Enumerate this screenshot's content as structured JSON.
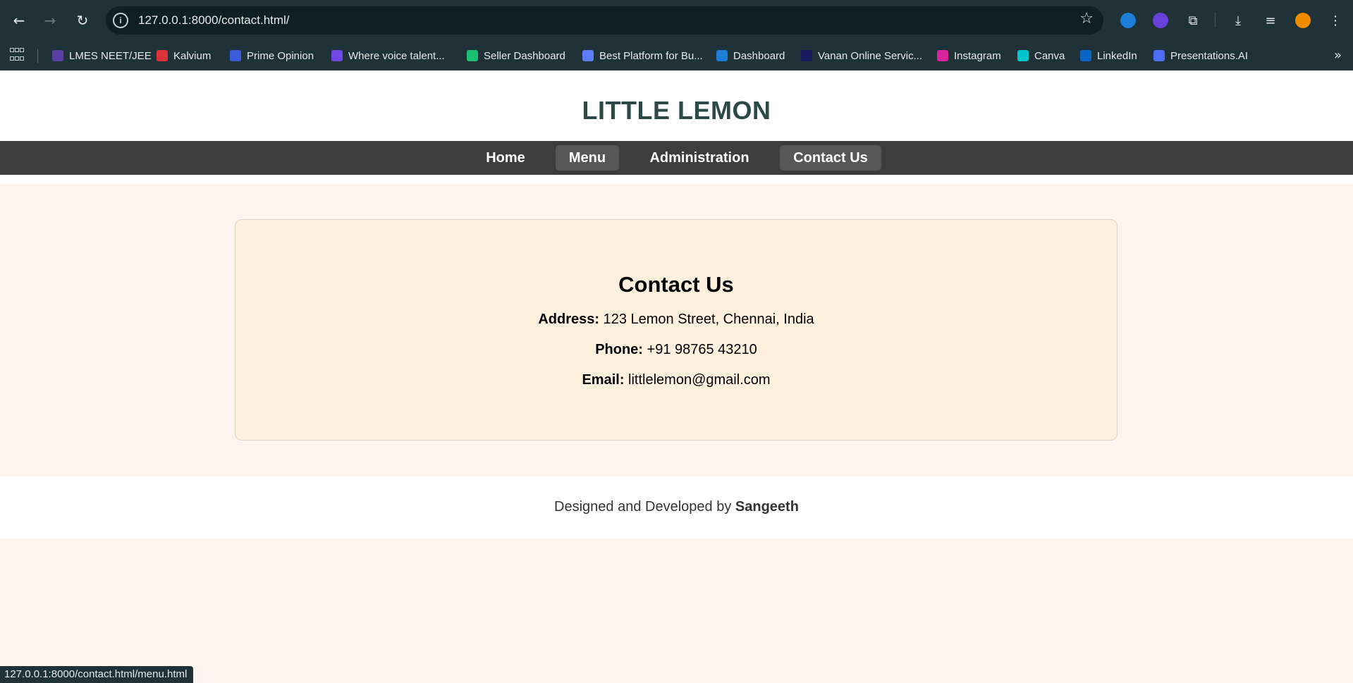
{
  "browser": {
    "url": "127.0.0.1:8000/contact.html/",
    "bookmarks": [
      {
        "label": "LMES NEET/JEE",
        "icon": "lmes-favicon",
        "color": "#5b3fa8"
      },
      {
        "label": "Kalvium",
        "icon": "kalvium-favicon",
        "color": "#e0323c"
      },
      {
        "label": "Prime Opinion",
        "icon": "prime-opinion-favicon",
        "color": "#3b5bdb"
      },
      {
        "label": "Where voice talent...",
        "icon": "voice-favicon",
        "color": "#7048e8"
      },
      {
        "label": "Seller Dashboard",
        "icon": "fiverr-favicon",
        "color": "#1dbf73"
      },
      {
        "label": "Best Platform for Bu...",
        "icon": "platform-favicon",
        "color": "#5c7cfa"
      },
      {
        "label": "Dashboard",
        "icon": "dashboard-favicon",
        "color": "#1c7ed6"
      },
      {
        "label": "Vanan Online Servic...",
        "icon": "vanan-favicon",
        "color": "#1a1a5e"
      },
      {
        "label": "Instagram",
        "icon": "instagram-favicon",
        "color": "#d6249f"
      },
      {
        "label": "Canva",
        "icon": "canva-favicon",
        "color": "#00c4cc"
      },
      {
        "label": "LinkedIn",
        "icon": "linkedin-favicon",
        "color": "#0a66c2"
      },
      {
        "label": "Presentations.AI",
        "icon": "presentations-favicon",
        "color": "#4c6ef5"
      }
    ],
    "status_url": "127.0.0.1:8000/contact.html/menu.html"
  },
  "site": {
    "title": "LITTLE LEMON",
    "nav": [
      {
        "label": "Home",
        "active": false
      },
      {
        "label": "Menu",
        "active": true
      },
      {
        "label": "Administration",
        "active": false
      },
      {
        "label": "Contact Us",
        "active": true
      }
    ]
  },
  "contact": {
    "heading": "Contact Us",
    "address_label": "Address:",
    "address": "123 Lemon Street, Chennai, India",
    "phone_label": "Phone:",
    "phone": "+91 98765 43210",
    "email_label": "Email:",
    "email": "littlelemon@gmail.com"
  },
  "footer": {
    "text": "Designed and Developed by",
    "author": "Sangeeth"
  },
  "colors": {
    "title": "#2e4a46",
    "nav_bg": "#3d3d3d",
    "card_bg": "#fff0dd",
    "page_bg": "#fdf4ef"
  }
}
